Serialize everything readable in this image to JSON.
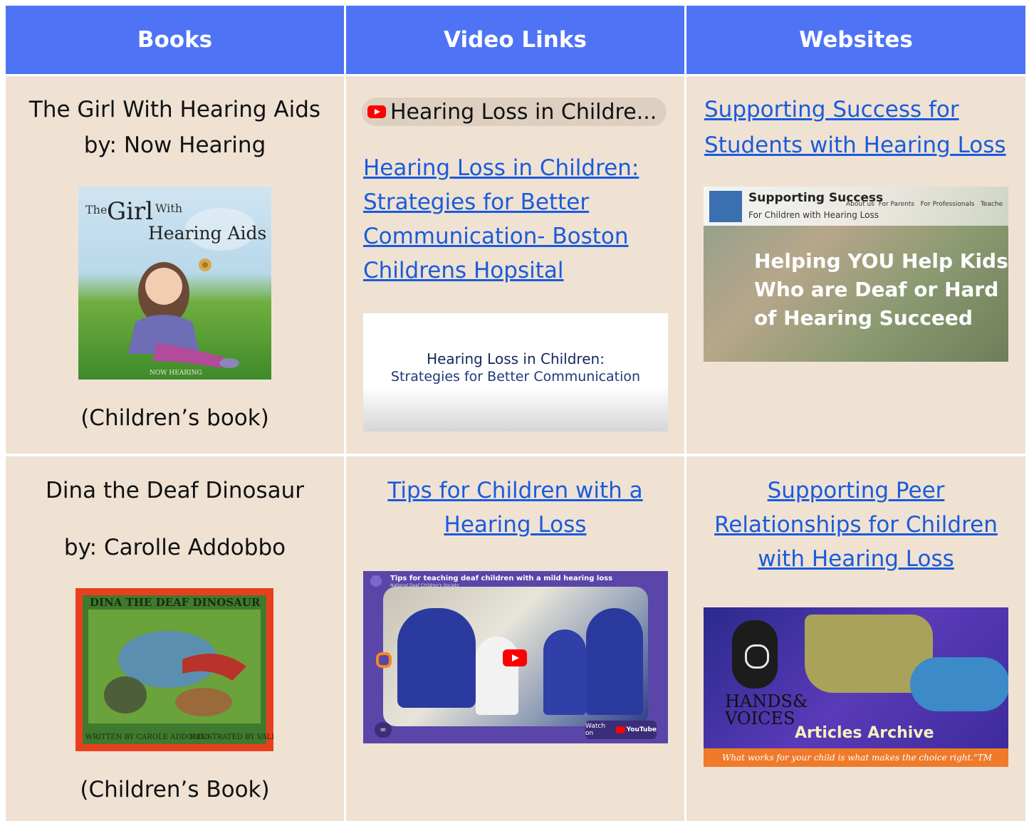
{
  "headers": [
    "Books",
    "Video Links",
    "Websites"
  ],
  "row1": {
    "book": {
      "title": "The Girl With Hearing Aids",
      "author": "by: Now Hearing",
      "cover_text": [
        "The",
        "Girl",
        "With",
        "Hearing Aids",
        "NOW HEARING"
      ],
      "type": "(Children’s book)"
    },
    "video": {
      "chip_title": "Hearing Loss in Childre...",
      "link_lines": [
        "Hearing Loss in Children:",
        "Strategies for Better",
        "Communication- Boston",
        "Childrens Hopsital"
      ],
      "thumb_title": "Hearing Loss in Children:",
      "thumb_subtitle": "Strategies for Better Communication"
    },
    "website": {
      "link_lines": [
        "Supporting Success for",
        "Students with Hearing Loss"
      ],
      "shot_brand": "Supporting Success",
      "shot_tagline": "For Children with Hearing Loss",
      "shot_nav": [
        "About us",
        "For Parents",
        "For Professionals",
        "Teache"
      ],
      "shot_headline": [
        "Helping YOU Help Kids",
        "Who are Deaf or Hard",
        "of Hearing Succeed"
      ]
    }
  },
  "row2": {
    "book": {
      "title": "Dina the Deaf Dinosaur",
      "author": "by: Carolle Addobbo",
      "cover_text": [
        "DINA THE DEAF DINOSAUR",
        "WRITTEN BY CAROLE ADDOBBO",
        "ILLUSTRATED BY VALENTINE"
      ],
      "type": "(Children’s Book)"
    },
    "video": {
      "link_lines": [
        "Tips for Children with a",
        "Hearing Loss"
      ],
      "embed_title": "Tips for teaching deaf children with a mild hearing loss",
      "embed_channel": "National Deaf Children's Society",
      "watch_on": "Watch on",
      "yt_brand": "YouTube"
    },
    "website": {
      "link_lines": [
        "Supporting Peer",
        "Relationships for Children",
        "with Hearing Loss"
      ],
      "logo_line1": "HANDS&",
      "logo_line2": "VOICES",
      "archive_title": "Articles Archive",
      "archive_tagline": "What works for your child is what makes the choice right.\"TM"
    }
  },
  "colors": {
    "header_bg": "#4e73f5",
    "cell_bg": "#efe2d3",
    "link": "#1a5bdc"
  }
}
